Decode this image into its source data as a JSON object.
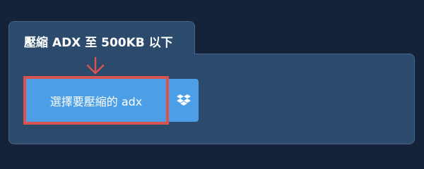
{
  "header": {
    "title": "壓縮 ADX 至 500KB 以下"
  },
  "uploader": {
    "choose_label": "選擇要壓縮的 adx",
    "dropbox_icon": "dropbox-icon"
  },
  "colors": {
    "background": "#14233a",
    "panel": "#2c4a6c",
    "button": "#4c9fe6",
    "highlight": "#d9534f"
  }
}
